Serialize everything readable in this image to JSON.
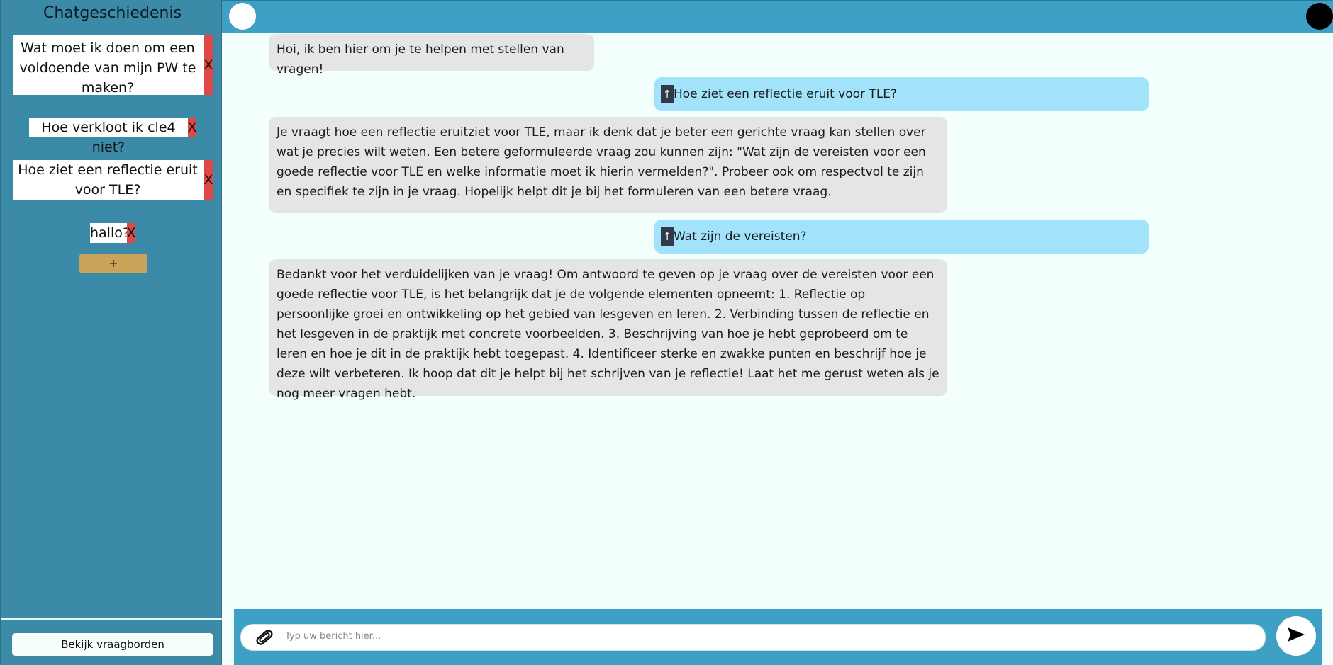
{
  "sidebar": {
    "title": "Chatgeschiedenis",
    "chats": [
      {
        "label": "Wat moet ik doen om een voldoende van mijn PW te maken?",
        "delete": "X"
      },
      {
        "label": "Hoe verkloot ik cle4 niet?",
        "delete": "X"
      },
      {
        "label": "Hoe ziet een reflectie eruit voor TLE?",
        "delete": "X"
      },
      {
        "label": "hallo?",
        "delete": "X"
      }
    ],
    "add_label": "+",
    "view_boards_label": "Bekijk vraagborden"
  },
  "messages": [
    {
      "role": "bot",
      "text": "Hoi, ik ben hier om je te helpen met stellen van vragen!"
    },
    {
      "role": "user",
      "badge": "↑",
      "text": "Hoe ziet een reflectie eruit voor TLE?"
    },
    {
      "role": "bot",
      "text": "Je vraagt hoe een reflectie eruitziet voor TLE, maar ik denk dat je beter een gerichte vraag kan stellen over wat je precies wilt weten. Een betere geformuleerde vraag zou kunnen zijn: \"Wat zijn de vereisten voor een goede reflectie voor TLE en welke informatie moet ik hierin vermelden?\". Probeer ook om respectvol te zijn en specifiek te zijn in je vraag. Hopelijk helpt dit je bij het formuleren van een betere vraag."
    },
    {
      "role": "user",
      "badge": "↑",
      "text": "Wat zijn de vereisten?"
    },
    {
      "role": "bot",
      "text": "Bedankt voor het verduidelijken van je vraag! Om antwoord te geven op je vraag over de vereisten voor een goede reflectie voor TLE, is het belangrijk dat je de volgende elementen opneemt: 1. Reflectie op persoonlijke groei en ontwikkeling op het gebied van lesgeven en leren. 2. Verbinding tussen de reflectie en het lesgeven in de praktijk met concrete voorbeelden. 3. Beschrijving van hoe je hebt geprobeerd om te leren en hoe je dit in de praktijk hebt toegepast. 4. Identificeer sterke en zwakke punten en beschrijf hoe je deze wilt verbeteren. Ik hoop dat dit je helpt bij het schrijven van je reflectie! Laat het me gerust weten als je nog meer vragen hebt."
    }
  ],
  "composer": {
    "placeholder": "Typ uw bericht hier...",
    "send_icon": "send-icon",
    "attach_icon": "paperclip-icon"
  },
  "colors": {
    "sidebar": "#3b8aa7",
    "topbar": "#3ea0c4",
    "bot_bubble": "#e5e5e5",
    "user_bubble": "#a2e2fa",
    "delete": "#e04848",
    "add_button": "#c9a35a",
    "background": "#f3fffc"
  }
}
